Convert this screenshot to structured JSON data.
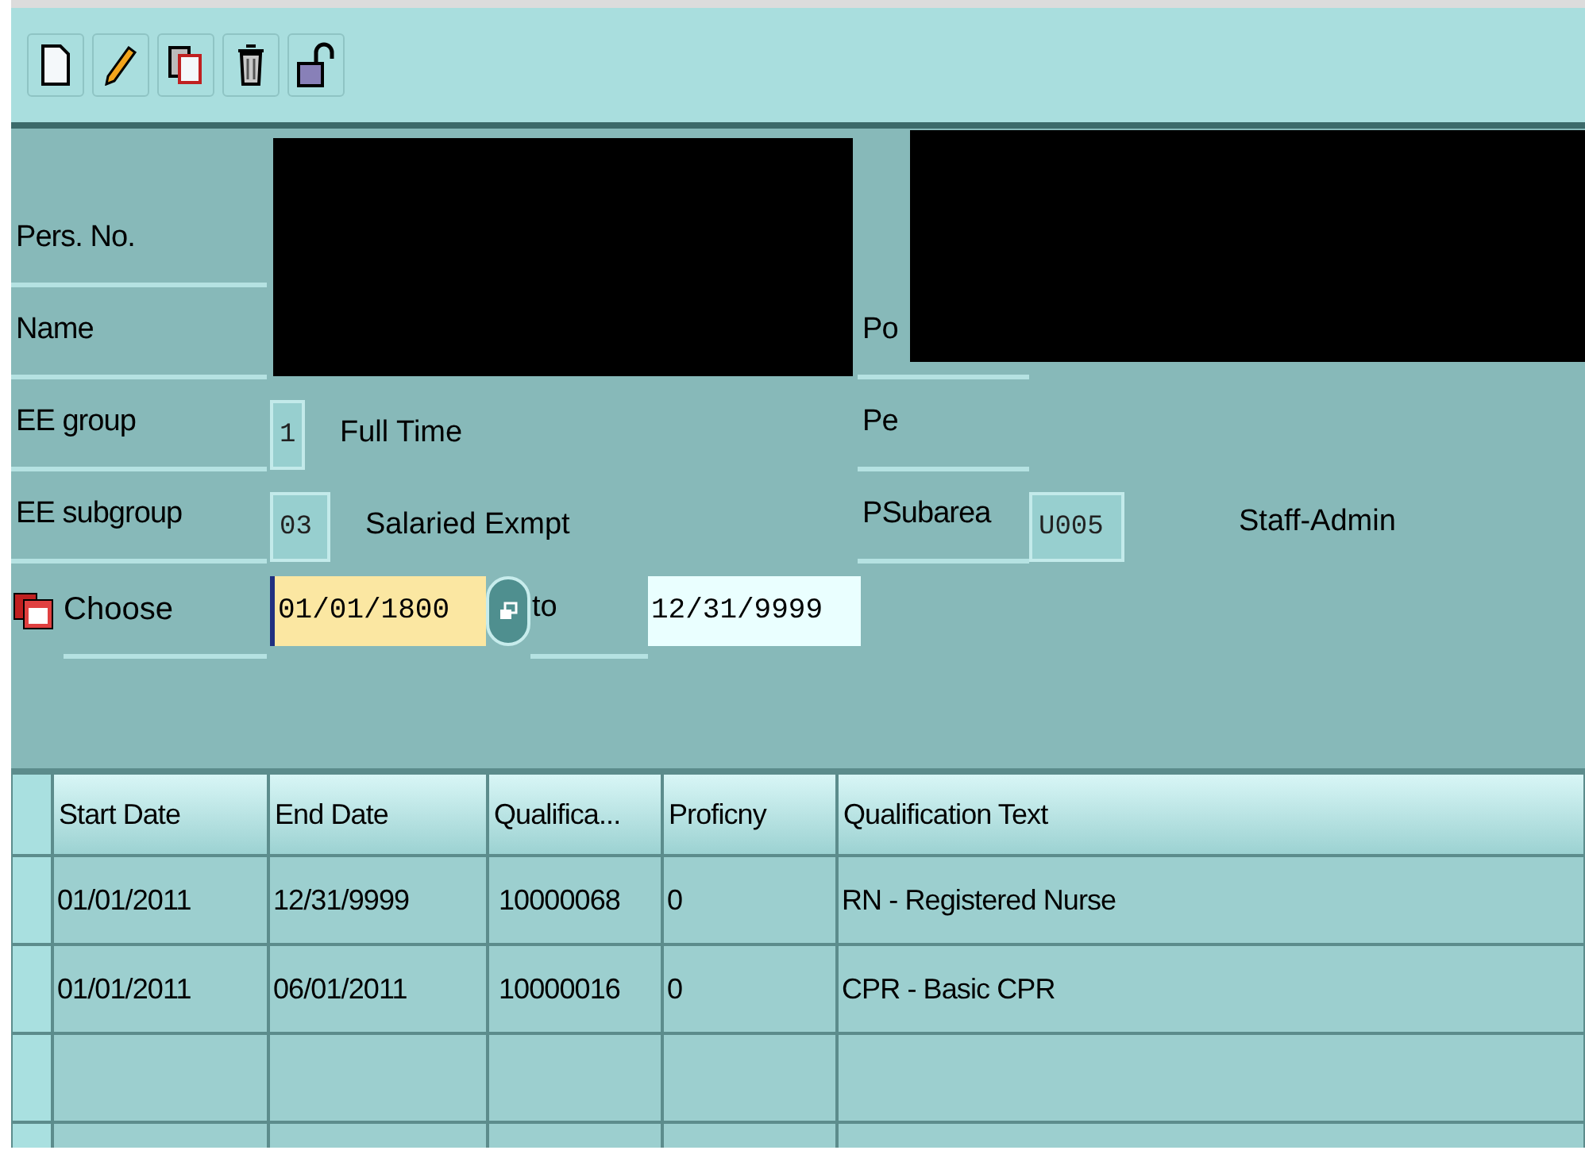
{
  "toolbar": {
    "buttons": [
      {
        "kind": "new"
      },
      {
        "kind": "edit"
      },
      {
        "kind": "copy"
      },
      {
        "kind": "delete"
      },
      {
        "kind": "lock"
      }
    ]
  },
  "header_left": [
    {
      "label": "Pers. No."
    },
    {
      "label": "Name"
    },
    {
      "label": "EE group",
      "value": "1",
      "text": "Full Time"
    },
    {
      "label": "EE subgroup",
      "value": "03",
      "text": "Salaried Exmpt"
    }
  ],
  "header_right": [
    {
      "label": "Po"
    },
    {
      "label": "Pe"
    },
    {
      "label": "PSubarea",
      "value": "U005",
      "text": "Staff-Admin"
    }
  ],
  "period": {
    "label": "Choose",
    "from": "01/01/1800",
    "to_label": "to",
    "to": "12/31/9999"
  },
  "table": {
    "columns": [
      "Start Date",
      "End Date",
      "Qualifica...",
      "Proficny",
      "Qualification Text"
    ],
    "rows": [
      [
        "01/01/2011",
        "12/31/9999",
        "10000068",
        "0",
        "RN - Registered Nurse"
      ],
      [
        "01/01/2011",
        "06/01/2011",
        "10000016",
        "0",
        "CPR - Basic CPR"
      ]
    ]
  }
}
